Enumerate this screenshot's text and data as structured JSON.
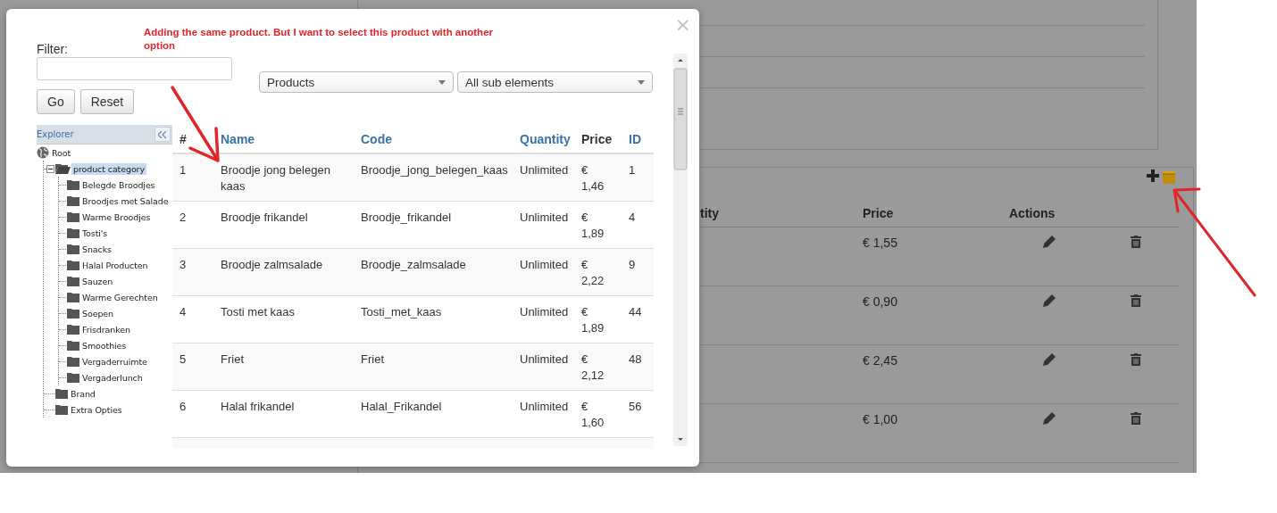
{
  "background_page": {
    "order_table": {
      "columns": [
        "tity",
        "Price",
        "Actions"
      ],
      "rows": [
        {
          "price": "€ 1,55"
        },
        {
          "price": "€ 0,90"
        },
        {
          "price": "€ 2,45"
        },
        {
          "price": "€ 1,00"
        }
      ]
    }
  },
  "annotation": {
    "text": "Adding the same product. But I want to select this product with another option"
  },
  "dialog": {
    "close": "×",
    "filter": {
      "label": "Filter:"
    },
    "buttons": [
      "Go",
      "Reset"
    ],
    "selects": [
      "Products",
      "All sub elements"
    ],
    "explorer": {
      "title": "Explorer",
      "tree": [
        {
          "label": "Root",
          "kind": "root",
          "selected": false,
          "children": [
            {
              "label": "product category",
              "kind": "folder",
              "expanded": true,
              "selected": true,
              "children": [
                {
                  "label": "Belegde Broodjes",
                  "kind": "folder",
                  "selected": false
                },
                {
                  "label": "Broodjes met Salade",
                  "kind": "folder",
                  "selected": false
                },
                {
                  "label": "Warme Broodjes",
                  "kind": "folder",
                  "selected": false
                },
                {
                  "label": "Tosti's",
                  "kind": "folder",
                  "selected": false
                },
                {
                  "label": "Snacks",
                  "kind": "folder",
                  "selected": false
                },
                {
                  "label": "Halal Producten",
                  "kind": "folder",
                  "selected": false
                },
                {
                  "label": "Sauzen",
                  "kind": "folder",
                  "selected": false
                },
                {
                  "label": "Warme Gerechten",
                  "kind": "folder",
                  "selected": false
                },
                {
                  "label": "Soepen",
                  "kind": "folder",
                  "selected": false
                },
                {
                  "label": "Frisdranken",
                  "kind": "folder",
                  "selected": false
                },
                {
                  "label": "Smoothies",
                  "kind": "folder",
                  "selected": false
                },
                {
                  "label": "Vergaderruimte",
                  "kind": "folder",
                  "selected": false
                },
                {
                  "label": "Vergaderlunch",
                  "kind": "folder",
                  "selected": false
                }
              ]
            },
            {
              "label": "Brand",
              "kind": "folder",
              "selected": false
            },
            {
              "label": "Extra Opties",
              "kind": "folder",
              "selected": false
            }
          ]
        }
      ]
    },
    "table": {
      "columns": [
        {
          "label": "#",
          "sortable": false
        },
        {
          "label": "Name",
          "sortable": true
        },
        {
          "label": "Code",
          "sortable": true
        },
        {
          "label": "Quantity",
          "sortable": true
        },
        {
          "label": "Price",
          "sortable": false
        },
        {
          "label": "ID",
          "sortable": true
        }
      ],
      "rows": [
        {
          "cells": [
            "1",
            "Broodje jong belegen kaas",
            "Broodje_jong_belegen_kaas",
            "Unlimited",
            "€ 1,46",
            "1"
          ]
        },
        {
          "cells": [
            "2",
            "Broodje frikandel",
            "Broodje_frikandel",
            "Unlimited",
            "€ 1,89",
            "4"
          ]
        },
        {
          "cells": [
            "3",
            "Broodje zalmsalade",
            "Broodje_zalmsalade",
            "Unlimited",
            "€ 2,22",
            "9"
          ]
        },
        {
          "cells": [
            "4",
            "Tosti met kaas",
            "Tosti_met_kaas",
            "Unlimited",
            "€ 1,89",
            "44"
          ]
        },
        {
          "cells": [
            "5",
            "Friet",
            "Friet",
            "Unlimited",
            "€ 2,12",
            "48"
          ]
        },
        {
          "cells": [
            "6",
            "Halal frikandel",
            "Halal_Frikandel",
            "Unlimited",
            "€ 1,60",
            "56"
          ]
        }
      ]
    }
  }
}
